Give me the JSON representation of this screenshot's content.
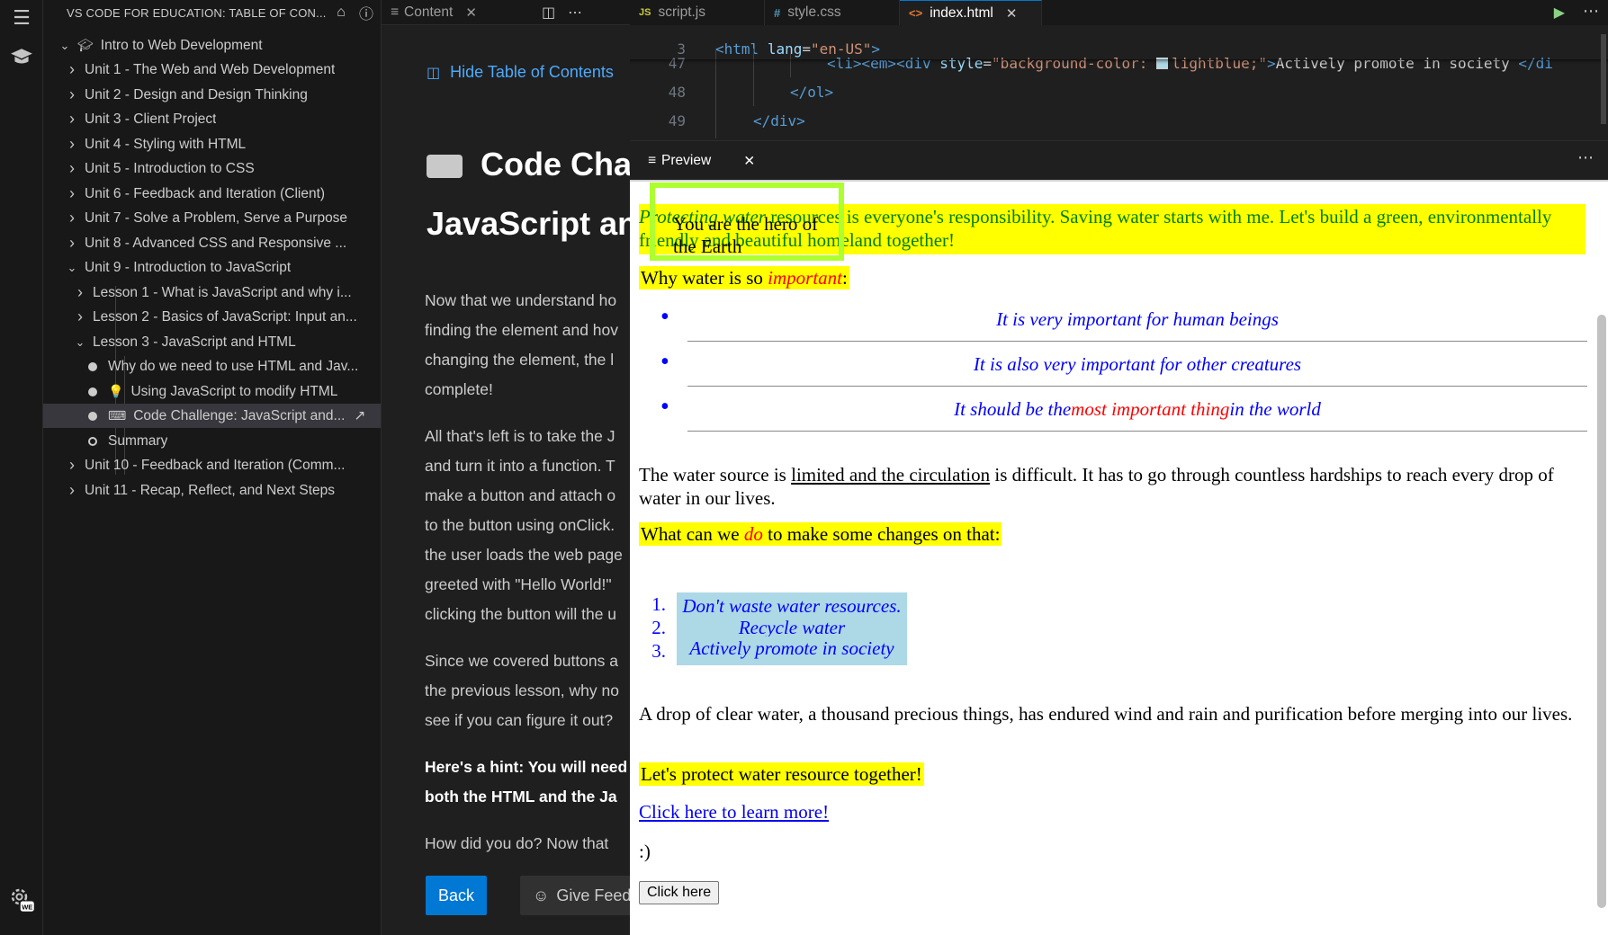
{
  "sidebar": {
    "title": "VS CODE FOR EDUCATION: TABLE OF CON...",
    "root": "Intro to Web Development",
    "units": [
      "Unit 1 - The Web and Web Development",
      "Unit 2 - Design and Design Thinking",
      "Unit 3 - Client Project",
      "Unit 4 - Styling with HTML",
      "Unit 5 - Introduction to CSS",
      "Unit 6 - Feedback and Iteration (Client)",
      "Unit 7 - Solve a Problem, Serve a Purpose",
      "Unit 8 - Advanced CSS and Responsive ...",
      "Unit 9 - Introduction to JavaScript"
    ],
    "lessons": [
      "Lesson 1 - What is JavaScript and why i...",
      "Lesson 2 - Basics of JavaScript: Input an...",
      "Lesson 3 - JavaScript and HTML"
    ],
    "lesson3_items": [
      "Why do we need to use HTML and Jav...",
      "Using JavaScript to modify HTML",
      "Code Challenge: JavaScript and...",
      "Summary"
    ],
    "units_after": [
      "Unit 10 - Feedback and Iteration (Comm...",
      "Unit 11 - Recap, Reflect, and Next Steps"
    ]
  },
  "content": {
    "tab_label": "Content",
    "hide_toc": "Hide Table of Contents",
    "title_line1": "Code Cha",
    "title_line2": "JavaScript an",
    "p1": [
      "Now that we understand ho",
      "finding the element and hov",
      "changing the element, the l",
      "complete!"
    ],
    "p2": [
      "All that's left is to take the J",
      "and turn it into a function. T",
      "make a button and attach o",
      "to the button using onClick.",
      "the user loads the web page",
      "greeted with \"Hello World!\"",
      "clicking the button will the u"
    ],
    "p3": [
      "Since we covered buttons a",
      "the previous lesson, why no",
      "see if you can figure it out?"
    ],
    "p4": [
      "Here's a hint: You will need",
      "both the HTML and the Ja"
    ],
    "p5": "How did you do? Now that",
    "back_label": "Back",
    "feedback_label": "Give Feed"
  },
  "editor": {
    "tabs": [
      {
        "icon": "JS",
        "label": "script.js"
      },
      {
        "icon": "#",
        "label": "style.css"
      },
      {
        "icon": "<>",
        "label": "index.html"
      }
    ],
    "lines": [
      {
        "num": "3",
        "code": "<html lang=\"en-US\">"
      },
      {
        "num": "47",
        "code": "<li><em><div style=\"background-color: lightblue;\">Actively promote in society </di"
      },
      {
        "num": "48",
        "code": "</ol>"
      },
      {
        "num": "49",
        "code": "</div>"
      }
    ]
  },
  "preview": {
    "tab_label": "Preview",
    "hero_box": "You are the hero of the Earth",
    "banner_italic": "Protecting water",
    "banner_rest": "resources is everyone's responsibility. Saving water starts with me. Let's build a green, environmentally friendly and beautiful homeland together!",
    "why_prefix": "Why water is so ",
    "why_emph": "important",
    "why_suffix": ":",
    "why_items": [
      "It is very important for human beings",
      "It is also very important for other creatures"
    ],
    "why_item3_a": "It should be the ",
    "why_item3_b": "most important thing",
    "why_item3_c": " in the world",
    "source_a": "The water source is ",
    "source_u": "limited and the circulation",
    "source_b": " is difficult. It has to go through countless hardships to reach every drop of water in our lives.",
    "what_prefix": "What can we ",
    "what_emph": "do",
    "what_suffix": " to make some changes on that:",
    "do_items": [
      "Don't waste water resources.",
      "Recycle water",
      "Actively promote in society"
    ],
    "drop_text": "A drop of clear water, a thousand precious things, has endured wind and rain and purification before merging into our lives.",
    "protect": "Let's protect water resource together!",
    "learn_more": "Click here to learn more!",
    "smiley": ":)",
    "click_here": "Click here"
  },
  "colors": {
    "accent": "#0078d4",
    "link": "#4daafc",
    "highlight_yellow": "#ffff00",
    "lightblue": "#add8e6",
    "hero_border": "#adff2f"
  }
}
